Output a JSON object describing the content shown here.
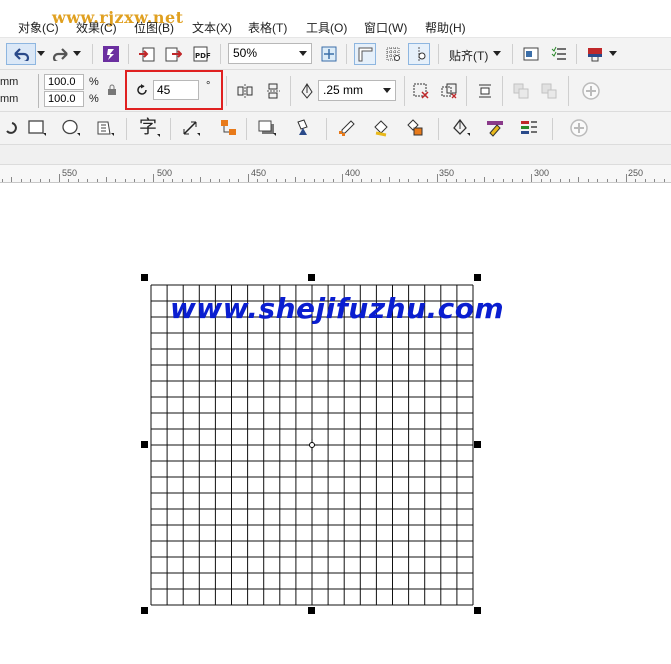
{
  "watermark": "www.rjzxw.net",
  "menu": [
    {
      "label": "对象(C)"
    },
    {
      "label": "效果(C)"
    },
    {
      "label": "位图(B)"
    },
    {
      "label": "文本(X)"
    },
    {
      "label": "表格(T)"
    },
    {
      "label": "工具(O)"
    },
    {
      "label": "窗口(W)"
    },
    {
      "label": "帮助(H)"
    }
  ],
  "toolbar": {
    "zoom_value": "50%",
    "snap_label": "贴齐(T)"
  },
  "property_bar": {
    "size_unit_1": "mm",
    "size_unit_2": "mm",
    "scale_x": "100.0",
    "scale_y": "100.0",
    "percent_1": "%",
    "percent_2": "%",
    "rotation_value": "45",
    "degree_symbol": "°",
    "outline_width": ".25 mm"
  },
  "ruler": {
    "labels": [
      "550",
      "500",
      "450",
      "400",
      "350",
      "300",
      "250"
    ]
  },
  "canvas": {
    "overlay_text": "www.shejifuzhu.com",
    "grid_columns": 20,
    "grid_rows": 20
  },
  "colors": {
    "highlight_box": "#e02020",
    "overlay_text": "#0a1ed0",
    "watermark": "#e0a020"
  }
}
